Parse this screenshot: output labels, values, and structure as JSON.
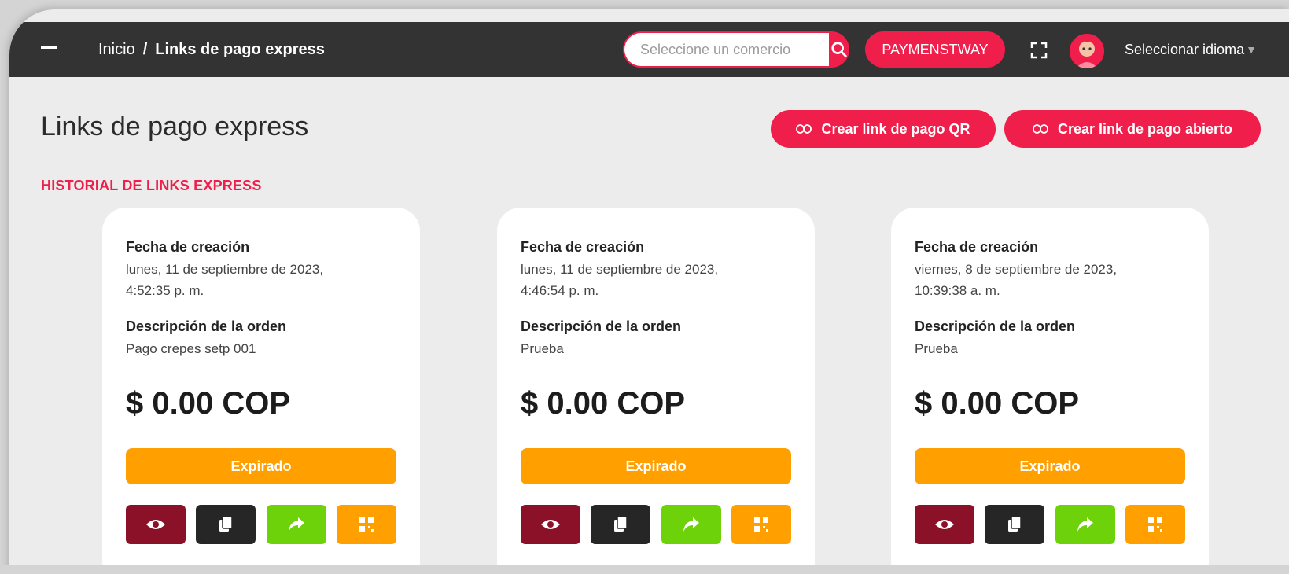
{
  "header": {
    "breadcrumb_home": "Inicio",
    "breadcrumb_separator": "/",
    "breadcrumb_current": "Links de pago express",
    "search_placeholder": "Seleccione un comercio",
    "brand_button": "PAYMENSTWAY",
    "language_label": "Seleccionar idioma",
    "language_caret": "▼"
  },
  "page": {
    "title": "Links de pago express",
    "btn_qr_label": "Crear link de pago QR",
    "btn_open_label": "Crear link de pago abierto",
    "section_title": "HISTORIAL DE LINKS EXPRESS"
  },
  "cards": [
    {
      "date_label": "Fecha de creación",
      "date_line1": "lunes, 11 de septiembre de 2023,",
      "date_line2": "4:52:35 p. m.",
      "desc_label": "Descripción de la orden",
      "desc_value": "Pago crepes setp 001",
      "amount": "$ 0.00 COP",
      "status": "Expirado"
    },
    {
      "date_label": "Fecha de creación",
      "date_line1": "lunes, 11 de septiembre de 2023,",
      "date_line2": "4:46:54 p. m.",
      "desc_label": "Descripción de la orden",
      "desc_value": "Prueba",
      "amount": "$ 0.00 COP",
      "status": "Expirado"
    },
    {
      "date_label": "Fecha de creación",
      "date_line1": "viernes, 8 de septiembre de 2023,",
      "date_line2": "10:39:38 a. m.",
      "desc_label": "Descripción de la orden",
      "desc_value": "Prueba",
      "amount": "$ 0.00 COP",
      "status": "Expirado"
    }
  ],
  "colors": {
    "accent": "#ef1e4a",
    "topbar": "#333333",
    "status_expired": "#ff9f00",
    "view": "#8b1128",
    "copy": "#262626",
    "share": "#6ed20b",
    "qr": "#ff9f00"
  },
  "icons": [
    "menu-icon",
    "search-icon",
    "fullscreen-icon",
    "avatar",
    "link-icon",
    "eye-icon",
    "copy-icon",
    "share-icon",
    "qr-icon"
  ]
}
